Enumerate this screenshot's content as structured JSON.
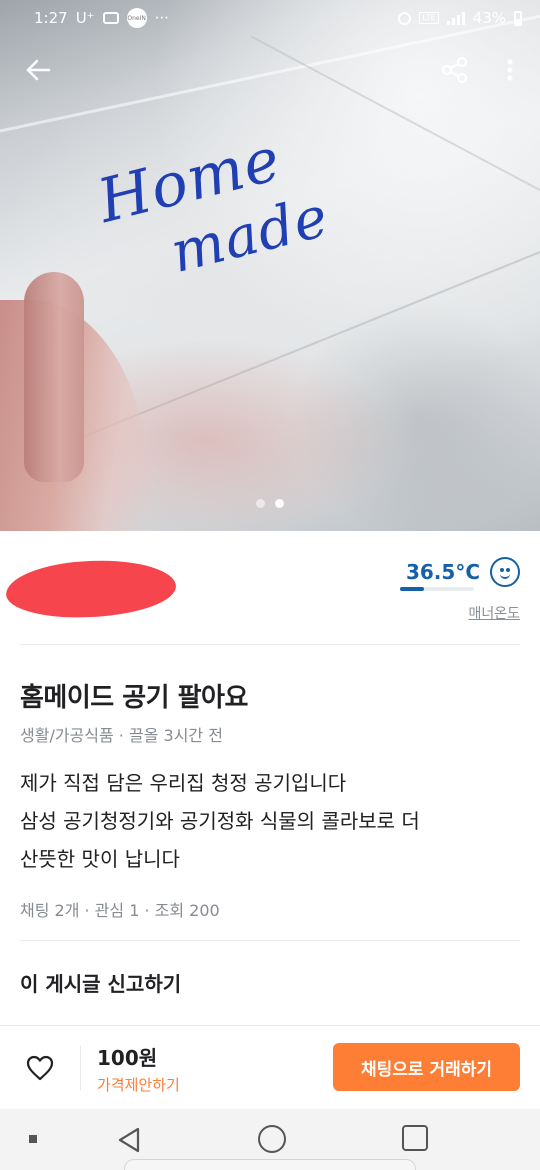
{
  "status_bar": {
    "time": "1:27",
    "carrier": "U⁺",
    "battery": "43%",
    "badge": "OneIN",
    "network": "LTE"
  },
  "photo": {
    "handwriting_line1": "Home",
    "handwriting_line2": "made",
    "dots_total": 2,
    "active_dot": 2
  },
  "seller": {
    "manner_temp": "36.5°C",
    "manner_label": "매너온도",
    "temp_fill_fraction": 0.33
  },
  "post": {
    "title": "홈메이드 공기 팔아요",
    "category": "생활/가공식품",
    "meta_separator": " · ",
    "time_ago": "끌올 3시간 전",
    "body_lines": [
      "제가 직접 담은 우리집 청정 공기입니다",
      "삼성 공기청정기와 공기정화 식물의 콜라보로 더",
      "산뜻한 맛이 납니다"
    ],
    "stats": "채팅 2개 · 관심 1 · 조회 200",
    "report_label": "이 게시글 신고하기"
  },
  "action_bar": {
    "price": "100원",
    "price_offer_label": "가격제안하기",
    "chat_button_label": "채팅으로 거래하기"
  },
  "colors": {
    "accent": "#ff7e36",
    "manner_blue": "#1561a9",
    "handwriting": "#1f3fb2",
    "redaction": "#f7454d"
  },
  "icons": [
    "back-arrow-icon",
    "share-icon",
    "more-vertical-icon",
    "heart-icon",
    "smile-face-icon",
    "nav-back-icon",
    "nav-home-icon",
    "nav-recents-icon"
  ]
}
